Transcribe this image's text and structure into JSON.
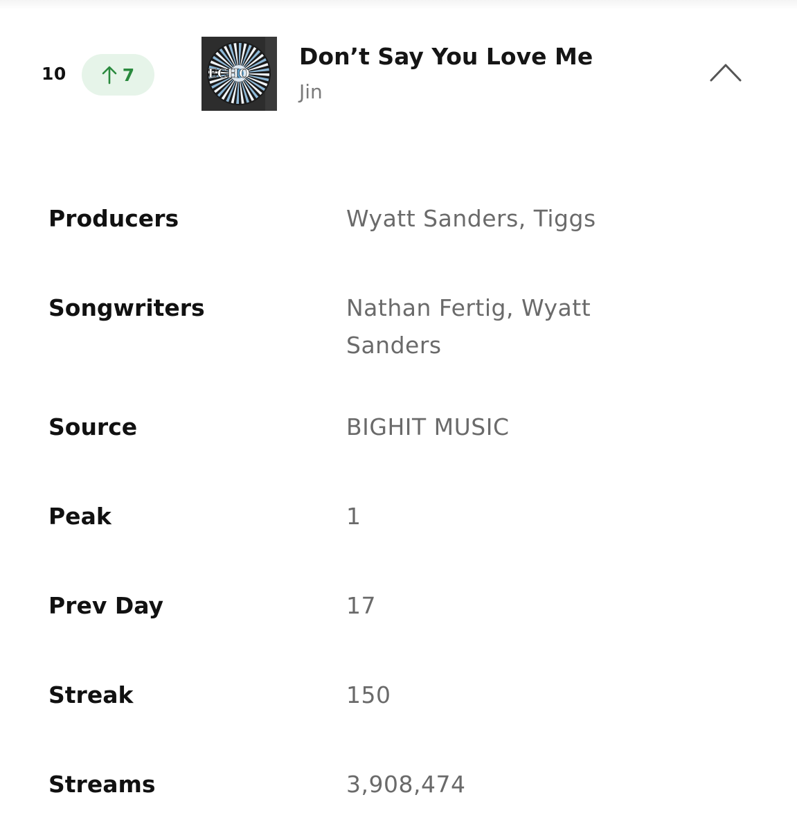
{
  "track": {
    "rank": "10",
    "movement": {
      "direction": "up",
      "value": "7",
      "color": "#2a8a3e",
      "background": "#e6f4e9"
    },
    "title": "Don’t Say You Love Me",
    "artist": "Jin",
    "cover_text": "ECHO",
    "collapse_icon": "chevron-up-icon"
  },
  "details": [
    {
      "label": "Producers",
      "value": "Wyatt Sanders, Tiggs"
    },
    {
      "label": "Songwriters",
      "value": "Nathan Fertig, Wyatt Sanders"
    },
    {
      "label": "Source",
      "value": "BIGHIT MUSIC"
    },
    {
      "label": "Peak",
      "value": "1"
    },
    {
      "label": "Prev Day",
      "value": "17"
    },
    {
      "label": "Streak",
      "value": "150"
    },
    {
      "label": "Streams",
      "value": "3,908,474"
    }
  ]
}
